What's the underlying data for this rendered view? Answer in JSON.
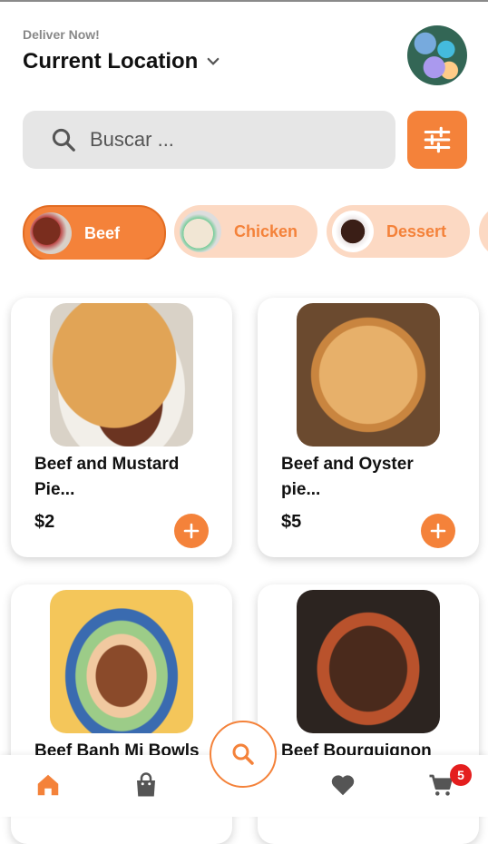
{
  "header": {
    "deliver_label": "Deliver Now!",
    "location": "Current Location"
  },
  "search": {
    "placeholder": "Buscar ..."
  },
  "categories": [
    {
      "label": "Beef",
      "active": true
    },
    {
      "label": "Chicken",
      "active": false
    },
    {
      "label": "Dessert",
      "active": false
    }
  ],
  "products": [
    {
      "name": "Beef and Mustard Pie...",
      "price": "$2"
    },
    {
      "name": "Beef and Oyster pie...",
      "price": "$5"
    },
    {
      "name": "Beef Banh Mi Bowls",
      "price": ""
    },
    {
      "name": "Beef Bourguignon",
      "price": ""
    }
  ],
  "cart": {
    "count": "5"
  },
  "colors": {
    "accent": "#f4823a",
    "accent_light": "#fcd9c3",
    "badge": "#e41e1e"
  },
  "icons": {
    "search": "search-icon",
    "filter": "filter-icon",
    "chevron": "chevron-down-icon",
    "home": "home-icon",
    "bag": "shopping-bag-icon",
    "heart": "heart-icon",
    "cart": "cart-icon",
    "add": "plus-icon"
  }
}
